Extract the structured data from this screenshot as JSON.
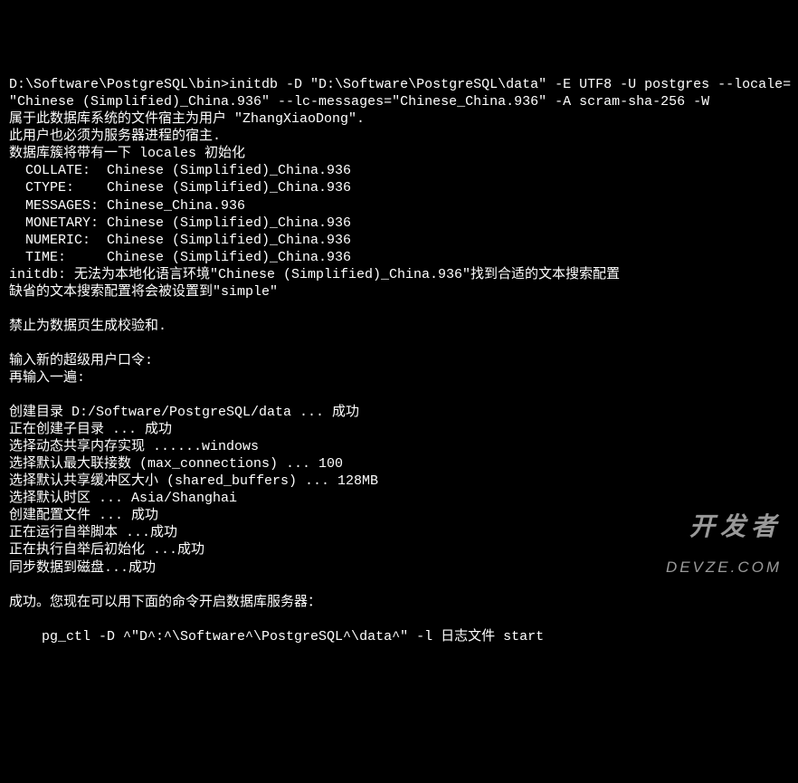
{
  "terminal": {
    "lines": [
      "D:\\Software\\PostgreSQL\\bin>initdb -D \"D:\\Software\\PostgreSQL\\data\" -E UTF8 -U postgres --locale=",
      "\"Chinese (Simplified)_China.936\" --lc-messages=\"Chinese_China.936\" -A scram-sha-256 -W",
      "属于此数据库系统的文件宿主为用户 \"ZhangXiaoDong\".",
      "此用户也必须为服务器进程的宿主.",
      "数据库簇将带有一下 locales 初始化",
      "  COLLATE:  Chinese (Simplified)_China.936",
      "  CTYPE:    Chinese (Simplified)_China.936",
      "  MESSAGES: Chinese_China.936",
      "  MONETARY: Chinese (Simplified)_China.936",
      "  NUMERIC:  Chinese (Simplified)_China.936",
      "  TIME:     Chinese (Simplified)_China.936",
      "initdb: 无法为本地化语言环境\"Chinese (Simplified)_China.936\"找到合适的文本搜索配置",
      "缺省的文本搜索配置将会被设置到\"simple\"",
      "",
      "禁止为数据页生成校验和.",
      "",
      "输入新的超级用户口令:",
      "再输入一遍:",
      "",
      "创建目录 D:/Software/PostgreSQL/data ... 成功",
      "正在创建子目录 ... 成功",
      "选择动态共享内存实现 ......windows",
      "选择默认最大联接数 (max_connections) ... 100",
      "选择默认共享缓冲区大小 (shared_buffers) ... 128MB",
      "选择默认时区 ... Asia/Shanghai",
      "创建配置文件 ... 成功",
      "正在运行自举脚本 ...成功",
      "正在执行自举后初始化 ...成功",
      "同步数据到磁盘...成功",
      "",
      "成功。您现在可以用下面的命令开启数据库服务器：",
      "",
      "    pg_ctl -D ^\"D^:^\\Software^\\PostgreSQL^\\data^\" -l 日志文件 start",
      ""
    ]
  },
  "watermark": {
    "top": "开发者",
    "bottom": "DEVZE.COM"
  }
}
